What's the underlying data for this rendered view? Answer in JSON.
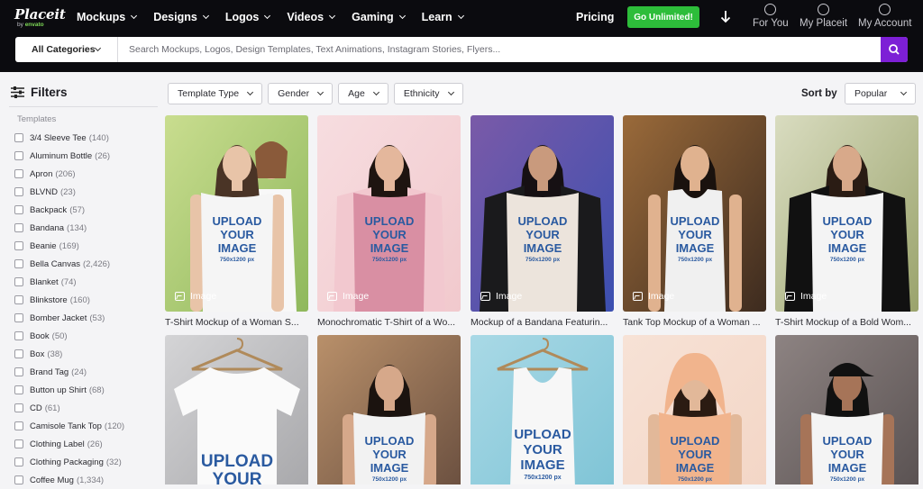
{
  "brand": {
    "logo_main": "Placeit",
    "logo_by": "by",
    "logo_envato": "envato"
  },
  "nav": {
    "items": [
      "Mockups",
      "Designs",
      "Logos",
      "Videos",
      "Gaming",
      "Learn"
    ],
    "pricing": "Pricing",
    "cta": "Go Unlimited!",
    "for_you": "For You",
    "my_placeit": "My Placeit",
    "my_account": "My Account"
  },
  "search": {
    "category": "All Categories",
    "placeholder": "Search Mockups, Logos, Design Templates, Text Animations, Instagram Stories, Flyers..."
  },
  "sidebar": {
    "title": "Filters",
    "section": "Templates",
    "items": [
      {
        "label": "3/4 Sleeve Tee",
        "count": "(140)"
      },
      {
        "label": "Aluminum Bottle",
        "count": "(26)"
      },
      {
        "label": "Apron",
        "count": "(206)"
      },
      {
        "label": "BLVND",
        "count": "(23)"
      },
      {
        "label": "Backpack",
        "count": "(57)"
      },
      {
        "label": "Bandana",
        "count": "(134)"
      },
      {
        "label": "Beanie",
        "count": "(169)"
      },
      {
        "label": "Bella Canvas",
        "count": "(2,426)"
      },
      {
        "label": "Blanket",
        "count": "(74)"
      },
      {
        "label": "Blinkstore",
        "count": "(160)"
      },
      {
        "label": "Bomber Jacket",
        "count": "(53)"
      },
      {
        "label": "Book",
        "count": "(50)"
      },
      {
        "label": "Box",
        "count": "(38)"
      },
      {
        "label": "Brand Tag",
        "count": "(24)"
      },
      {
        "label": "Button up Shirt",
        "count": "(68)"
      },
      {
        "label": "CD",
        "count": "(61)"
      },
      {
        "label": "Camisole Tank Top",
        "count": "(120)"
      },
      {
        "label": "Clothing Label",
        "count": "(26)"
      },
      {
        "label": "Clothing Packaging",
        "count": "(32)"
      },
      {
        "label": "Coffee Mug",
        "count": "(1,334)"
      }
    ]
  },
  "filterbar": {
    "filters": [
      "Template Type",
      "Gender",
      "Age",
      "Ethnicity"
    ],
    "sort_label": "Sort by",
    "sort_value": "Popular"
  },
  "grid": {
    "badge": "Image",
    "placeholder_line1": "UPLOAD",
    "placeholder_line2": "YOUR",
    "placeholder_line3": "IMAGE",
    "placeholder_size": "750x1200 px",
    "cards": [
      {
        "title": "T-Shirt Mockup of a Woman S..."
      },
      {
        "title": "Monochromatic T-Shirt of a Wo..."
      },
      {
        "title": "Mockup of a Bandana Featurin..."
      },
      {
        "title": "Tank Top Mockup of a Woman ..."
      },
      {
        "title": "T-Shirt Mockup of a Bold Wom..."
      },
      {
        "title": ""
      },
      {
        "title": ""
      },
      {
        "title": ""
      },
      {
        "title": ""
      },
      {
        "title": ""
      }
    ]
  },
  "colors": {
    "accent": "#7d1fd6",
    "cta": "#2dbd3a",
    "nav_bg": "#0b0b0f"
  }
}
